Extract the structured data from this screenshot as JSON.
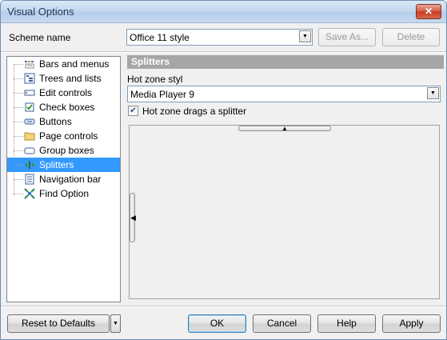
{
  "window": {
    "title": "Visual Options",
    "close_label": "✕"
  },
  "scheme": {
    "label": "Scheme name",
    "value": "Office 11 style",
    "save_as": "Save As...",
    "delete": "Delete"
  },
  "tree": {
    "items": [
      {
        "label": "Bars and menus",
        "icon": "bars-menus-icon"
      },
      {
        "label": "Trees and lists",
        "icon": "trees-lists-icon"
      },
      {
        "label": "Edit controls",
        "icon": "edit-controls-icon"
      },
      {
        "label": "Check boxes",
        "icon": "checkbox-icon"
      },
      {
        "label": "Buttons",
        "icon": "button-icon"
      },
      {
        "label": "Page controls",
        "icon": "folder-icon"
      },
      {
        "label": "Group boxes",
        "icon": "group-box-icon"
      },
      {
        "label": "Splitters",
        "icon": "splitter-icon",
        "selected": true
      },
      {
        "label": "Navigation bar",
        "icon": "navigation-bar-icon"
      },
      {
        "label": "Find Option",
        "icon": "find-option-icon"
      }
    ]
  },
  "panel": {
    "header": "Splitters",
    "hot_zone_label": "Hot zone styl",
    "hot_zone_value": "Media Player 9",
    "drags_label": "Hot zone drags a splitter",
    "drags_checked": true
  },
  "footer": {
    "reset": "Reset to Defaults",
    "ok": "OK",
    "cancel": "Cancel",
    "help": "Help",
    "apply": "Apply"
  },
  "colors": {
    "selection": "#3399ff",
    "header_bg": "#a6a6a6"
  }
}
